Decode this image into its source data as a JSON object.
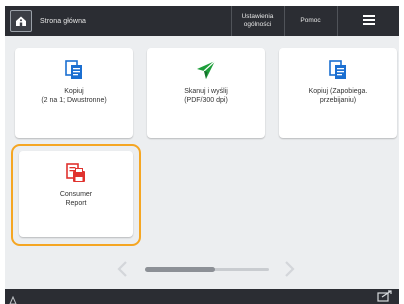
{
  "header": {
    "home_label": "Strona główna",
    "settings_label": "Ustawienia\nogólności",
    "help_label": "Pomoc"
  },
  "tiles": [
    {
      "label": "Kopiuj\n(2 na 1; Dwustronne)",
      "icon": "copy-icon"
    },
    {
      "label": "Skanuj i wyślij\n(PDF/300 dpi)",
      "icon": "send-icon"
    },
    {
      "label": "Kopiuj (Zapobiega.\nprzebijaniu)",
      "icon": "copy-icon"
    },
    {
      "label": "Consumer\nReport",
      "icon": "report-icon"
    }
  ],
  "colors": {
    "accent": "#f5a623",
    "topbar": "#2b2d33",
    "background": "#eceef0",
    "icon_blue": "#1b6fd1",
    "icon_green": "#1d9e3a",
    "icon_red": "#e0322e"
  },
  "pager": {
    "position": 0.3
  }
}
